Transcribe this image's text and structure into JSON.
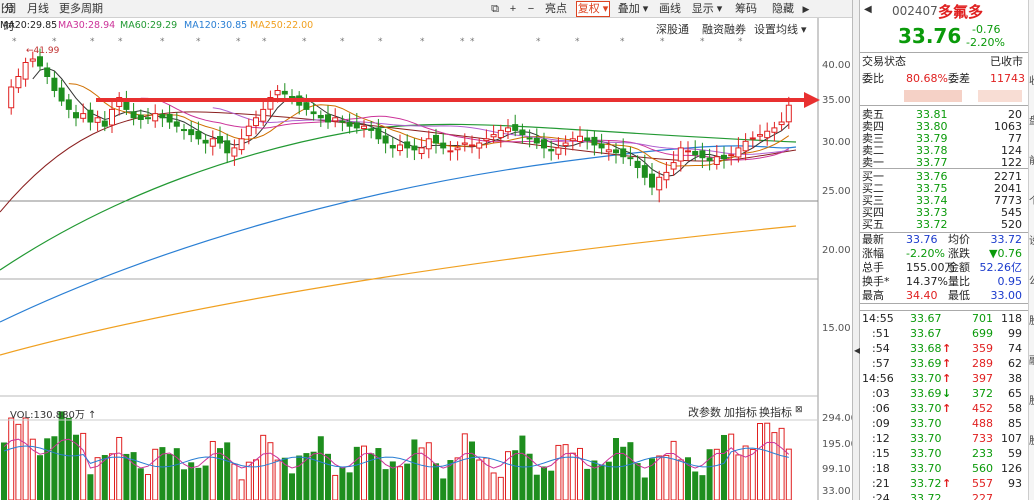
{
  "toolbar": {
    "items": [
      "分时",
      "日线",
      "周线",
      "月线",
      "更多周期",
      "+",
      "−",
      "亮点",
      "复权",
      "叠加",
      "画线",
      "显示",
      "筹码",
      "隐藏"
    ]
  },
  "ma_labels": [
    {
      "text": "MA20:29.85",
      "color": "#222222"
    },
    {
      "text": "MA30:28.94",
      "color": "#cc3399"
    },
    {
      "text": "MA60:29.29",
      "color": "#229933"
    },
    {
      "text": "MA120:30.85",
      "color": "#2a7fd4"
    },
    {
      "text": "MA250:22.00",
      "color": "#f0a020"
    }
  ],
  "sub_buttons": [
    "深股通",
    "融资融券",
    "设置均线"
  ],
  "peak_label": "41.99",
  "price_axis": [
    "40.00",
    "35.00",
    "30.00",
    "25.00",
    "20.00",
    "15.00"
  ],
  "volume": {
    "label": "VOL:130.880万",
    "buttons": [
      "改参数",
      "加指标",
      "换指标"
    ],
    "axis": [
      "294.00",
      "195.00",
      "99.10",
      "33.00"
    ]
  },
  "quote": {
    "code": "002407",
    "name": "多氟多",
    "price": "33.76",
    "change": "-0.76",
    "change_pct": "-2.20%",
    "status_label": "交易状态",
    "status": "已收市",
    "weibi_label": "委比",
    "weibi": "80.68%",
    "weicha_label": "委差",
    "weicha": "11743",
    "asks": [
      {
        "label": "卖五",
        "price": "33.81",
        "vol": "20"
      },
      {
        "label": "卖四",
        "price": "33.80",
        "vol": "1063"
      },
      {
        "label": "卖三",
        "price": "33.79",
        "vol": "77"
      },
      {
        "label": "卖二",
        "price": "33.78",
        "vol": "124"
      },
      {
        "label": "卖一",
        "price": "33.77",
        "vol": "122"
      }
    ],
    "bids": [
      {
        "label": "买一",
        "price": "33.76",
        "vol": "2271"
      },
      {
        "label": "买二",
        "price": "33.75",
        "vol": "2041"
      },
      {
        "label": "买三",
        "price": "33.74",
        "vol": "7773"
      },
      {
        "label": "买四",
        "price": "33.73",
        "vol": "545"
      },
      {
        "label": "买五",
        "price": "33.72",
        "vol": "520"
      }
    ],
    "stats": [
      {
        "l1": "最新",
        "v1": "33.76",
        "l2": "均价",
        "v2": "33.72",
        "c1": "bl",
        "c2": "bl"
      },
      {
        "l1": "涨幅",
        "v1": "-2.20%",
        "l2": "涨跌",
        "v2": "▼0.76",
        "c1": "dn",
        "c2": "dn"
      },
      {
        "l1": "总手",
        "v1": "155.00万",
        "l2": "金额",
        "v2": "52.26亿",
        "c1": "blk",
        "c2": "bl"
      },
      {
        "l1": "换手*",
        "v1": "14.37%",
        "l2": "量比",
        "v2": "0.95",
        "c1": "blk",
        "c2": "bl"
      },
      {
        "l1": "最高",
        "v1": "34.40",
        "l2": "最低",
        "v2": "33.00",
        "c1": "up",
        "c2": "bl"
      }
    ],
    "ticks": [
      {
        "t": "14:55",
        "p": "33.67",
        "a": "",
        "v": "701",
        "n": "118",
        "pc": "dn",
        "vc": "dn"
      },
      {
        "t": ":51",
        "p": "33.67",
        "a": "",
        "v": "699",
        "n": "99",
        "pc": "dn",
        "vc": "dn"
      },
      {
        "t": ":54",
        "p": "33.68",
        "a": "↑",
        "v": "359",
        "n": "74",
        "pc": "dn",
        "vc": "up"
      },
      {
        "t": ":57",
        "p": "33.69",
        "a": "↑",
        "v": "289",
        "n": "62",
        "pc": "dn",
        "vc": "up"
      },
      {
        "t": "14:56",
        "p": "33.70",
        "a": "↑",
        "v": "397",
        "n": "38",
        "pc": "dn",
        "vc": "up"
      },
      {
        "t": ":03",
        "p": "33.69",
        "a": "↓",
        "v": "372",
        "n": "65",
        "pc": "dn",
        "vc": "dn"
      },
      {
        "t": ":06",
        "p": "33.70",
        "a": "↑",
        "v": "452",
        "n": "58",
        "pc": "dn",
        "vc": "up"
      },
      {
        "t": ":09",
        "p": "33.70",
        "a": "",
        "v": "488",
        "n": "85",
        "pc": "dn",
        "vc": "up"
      },
      {
        "t": ":12",
        "p": "33.70",
        "a": "",
        "v": "733",
        "n": "107",
        "pc": "dn",
        "vc": "up"
      },
      {
        "t": ":15",
        "p": "33.70",
        "a": "",
        "v": "233",
        "n": "59",
        "pc": "dn",
        "vc": "dn"
      },
      {
        "t": ":18",
        "p": "33.70",
        "a": "",
        "v": "560",
        "n": "126",
        "pc": "dn",
        "vc": "dn"
      },
      {
        "t": ":21",
        "p": "33.72",
        "a": "↑",
        "v": "557",
        "n": "93",
        "pc": "dn",
        "vc": "up"
      },
      {
        "t": ":24",
        "p": "33.72",
        "a": "",
        "v": "227",
        "n": "",
        "pc": "dn",
        "vc": "up"
      }
    ]
  },
  "edge_chars": [
    "收",
    "盘",
    "前",
    "个",
    "设",
    "公",
    "股",
    "融",
    "股",
    "股"
  ],
  "colors": {
    "up": "#e02020",
    "down": "#0a9a0a",
    "arrow": "#e83030",
    "ma120": "#2a7fd4",
    "ma250": "#f0a020",
    "ma60": "#229933"
  }
}
